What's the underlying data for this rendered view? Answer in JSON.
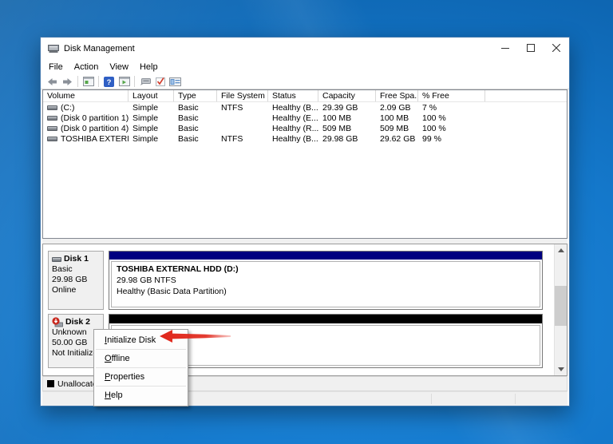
{
  "window": {
    "title": "Disk Management",
    "menu": [
      "File",
      "Action",
      "View",
      "Help"
    ]
  },
  "toolbar": {
    "icons": [
      "back",
      "forward",
      "show-console-tree",
      "help",
      "show-action-pane",
      "action-pointer",
      "task-check",
      "properties"
    ]
  },
  "volume_table": {
    "columns": [
      "Volume",
      "Layout",
      "Type",
      "File System",
      "Status",
      "Capacity",
      "Free Spa...",
      "% Free"
    ],
    "rows": [
      {
        "volume": "(C:)",
        "layout": "Simple",
        "type": "Basic",
        "fs": "NTFS",
        "status": "Healthy (B...",
        "capacity": "29.39 GB",
        "free": "2.09 GB",
        "pct": "7 %"
      },
      {
        "volume": "(Disk 0 partition 1)",
        "layout": "Simple",
        "type": "Basic",
        "fs": "",
        "status": "Healthy (E...",
        "capacity": "100 MB",
        "free": "100 MB",
        "pct": "100 %"
      },
      {
        "volume": "(Disk 0 partition 4)",
        "layout": "Simple",
        "type": "Basic",
        "fs": "",
        "status": "Healthy (R...",
        "capacity": "509 MB",
        "free": "509 MB",
        "pct": "100 %"
      },
      {
        "volume": "TOSHIBA EXTERN...",
        "layout": "Simple",
        "type": "Basic",
        "fs": "NTFS",
        "status": "Healthy (B...",
        "capacity": "29.98 GB",
        "free": "29.62 GB",
        "pct": "99 %"
      }
    ]
  },
  "disks": {
    "disk1": {
      "name": "Disk 1",
      "type": "Basic",
      "size": "29.98 GB",
      "status": "Online",
      "partition": {
        "title": "TOSHIBA EXTERNAL HDD  (D:)",
        "line2": "29.98 GB NTFS",
        "line3": "Healthy (Basic Data Partition)"
      }
    },
    "disk2": {
      "name": "Disk 2",
      "type": "Unknown",
      "size": "50.00 GB",
      "status": "Not Initialized"
    }
  },
  "context_menu": {
    "items": [
      "Initialize Disk",
      "Offline",
      "Properties",
      "Help"
    ]
  },
  "legend": {
    "unallocated_label": "Unallocated"
  },
  "colors": {
    "primary_partition_bar": "#000080",
    "unallocated_bar": "#000000",
    "annotation_arrow": "#e0261a",
    "desktop_blue": "#1478cb"
  }
}
